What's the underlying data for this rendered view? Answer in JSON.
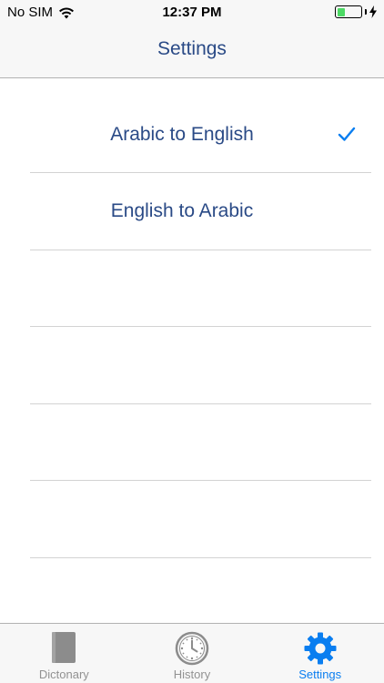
{
  "status_bar": {
    "carrier": "No SIM",
    "time": "12:37 PM",
    "battery_level": 0.35
  },
  "nav": {
    "title": "Settings"
  },
  "list": {
    "items": [
      {
        "label": "Arabic to English",
        "selected": true
      },
      {
        "label": "English to Arabic",
        "selected": false
      }
    ],
    "empty_rows": 4
  },
  "tab_bar": {
    "tabs": [
      {
        "label": "Dictonary",
        "icon": "book-icon",
        "active": false
      },
      {
        "label": "History",
        "icon": "clock-icon",
        "active": false
      },
      {
        "label": "Settings",
        "icon": "gear-icon",
        "active": true
      }
    ]
  },
  "colors": {
    "accent": "#0a7ef0",
    "title_text": "#2a4a86",
    "inactive_tab": "#929292",
    "battery": "#4cd964"
  }
}
